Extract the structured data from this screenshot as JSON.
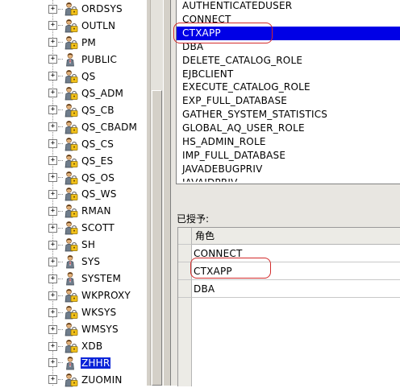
{
  "tree": {
    "items": [
      {
        "label": "ORDSYS",
        "icon": "role-user-icon"
      },
      {
        "label": "OUTLN",
        "icon": "role-user-icon"
      },
      {
        "label": "PM",
        "icon": "role-user-icon"
      },
      {
        "label": "PUBLIC",
        "icon": "user-icon"
      },
      {
        "label": "QS",
        "icon": "role-user-icon"
      },
      {
        "label": "QS_ADM",
        "icon": "role-user-icon"
      },
      {
        "label": "QS_CB",
        "icon": "role-user-icon"
      },
      {
        "label": "QS_CBADM",
        "icon": "role-user-icon"
      },
      {
        "label": "QS_CS",
        "icon": "role-user-icon"
      },
      {
        "label": "QS_ES",
        "icon": "role-user-icon"
      },
      {
        "label": "QS_OS",
        "icon": "role-user-icon"
      },
      {
        "label": "QS_WS",
        "icon": "role-user-icon"
      },
      {
        "label": "RMAN",
        "icon": "role-user-icon"
      },
      {
        "label": "SCOTT",
        "icon": "role-user-icon"
      },
      {
        "label": "SH",
        "icon": "role-user-icon"
      },
      {
        "label": "SYS",
        "icon": "user-icon"
      },
      {
        "label": "SYSTEM",
        "icon": "user-icon"
      },
      {
        "label": "WKPROXY",
        "icon": "role-user-icon"
      },
      {
        "label": "WKSYS",
        "icon": "role-user-icon"
      },
      {
        "label": "WMSYS",
        "icon": "role-user-icon"
      },
      {
        "label": "XDB",
        "icon": "role-user-icon"
      },
      {
        "label": "ZHHR",
        "icon": "user-icon",
        "selected": true
      },
      {
        "label": "ZUOMIN",
        "icon": "role-user-icon"
      }
    ],
    "expander_glyph": "+"
  },
  "available_roles": [
    "AUTHENTICATEDUSER",
    "CONNECT",
    "CTXAPP",
    "DBA",
    "DELETE_CATALOG_ROLE",
    "EJBCLIENT",
    "EXECUTE_CATALOG_ROLE",
    "EXP_FULL_DATABASE",
    "GATHER_SYSTEM_STATISTICS",
    "GLOBAL_AQ_USER_ROLE",
    "HS_ADMIN_ROLE",
    "IMP_FULL_DATABASE",
    "JAVADEBUGPRIV",
    "JAVAIDPRIV"
  ],
  "available_selected": "CTXAPP",
  "granted": {
    "label": "已授予:",
    "column_header": "角色",
    "rows": [
      "CONNECT",
      "CTXAPP",
      "DBA"
    ]
  },
  "colors": {
    "selection": "#0000e6",
    "tree_selection": "#0a24d8",
    "highlight_oval": "#d22a2a"
  }
}
